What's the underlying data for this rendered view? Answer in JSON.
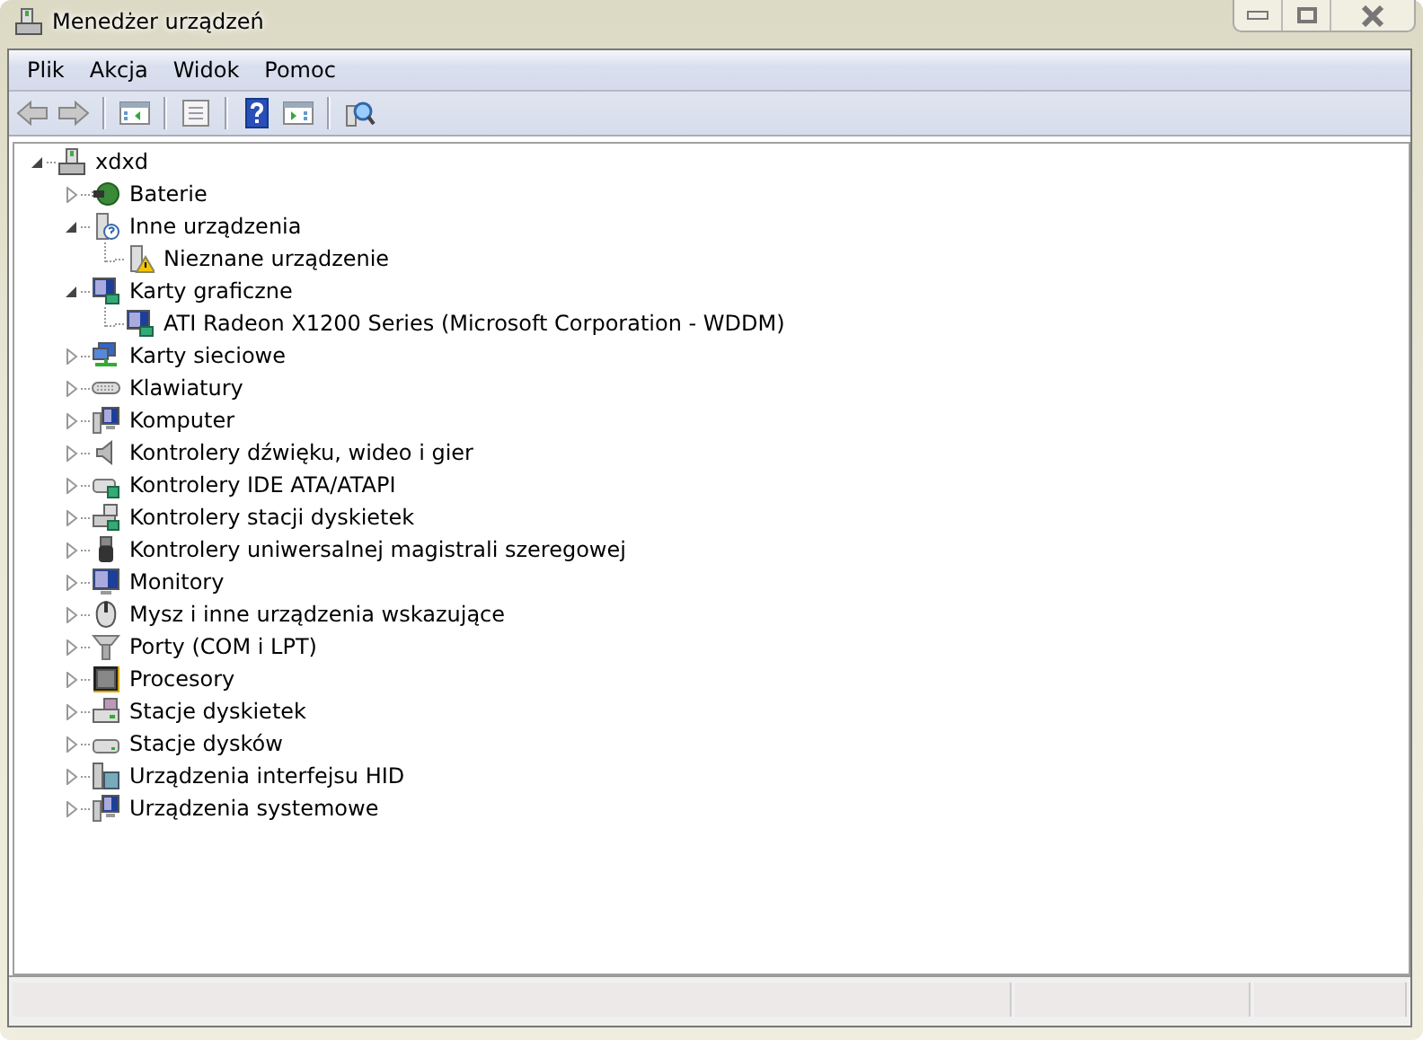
{
  "window": {
    "title": "Menedżer urządzeń"
  },
  "menu": [
    "Plik",
    "Akcja",
    "Widok",
    "Pomoc"
  ],
  "toolbar": [
    {
      "kind": "back"
    },
    {
      "kind": "forward"
    },
    {
      "kind": "separator"
    },
    {
      "kind": "tree-pane"
    },
    {
      "kind": "separator"
    },
    {
      "kind": "properties"
    },
    {
      "kind": "separator"
    },
    {
      "kind": "help"
    },
    {
      "kind": "action-pane"
    },
    {
      "kind": "separator"
    },
    {
      "kind": "scan"
    }
  ],
  "tree": {
    "label": "xdxd",
    "kind": "computer",
    "expanded": true,
    "children": [
      {
        "label": "Baterie",
        "kind": "battery",
        "expanded": false
      },
      {
        "label": "Inne urządzenia",
        "kind": "other",
        "expanded": true,
        "children": [
          {
            "label": "Nieznane urządzenie",
            "kind": "unknown"
          }
        ]
      },
      {
        "label": "Karty graficzne",
        "kind": "display",
        "expanded": true,
        "children": [
          {
            "label": "ATI Radeon X1200 Series (Microsoft Corporation - WDDM)",
            "kind": "display"
          }
        ]
      },
      {
        "label": "Karty sieciowe",
        "kind": "network",
        "expanded": false
      },
      {
        "label": "Klawiatury",
        "kind": "keyboard",
        "expanded": false
      },
      {
        "label": "Komputer",
        "kind": "pc",
        "expanded": false
      },
      {
        "label": "Kontrolery dźwięku, wideo i gier",
        "kind": "sound",
        "expanded": false
      },
      {
        "label": "Kontrolery IDE ATA/ATAPI",
        "kind": "controller",
        "expanded": false
      },
      {
        "label": "Kontrolery stacji dyskietek",
        "kind": "floppy-controller",
        "expanded": false
      },
      {
        "label": "Kontrolery uniwersalnej magistrali szeregowej",
        "kind": "usb",
        "expanded": false
      },
      {
        "label": "Monitory",
        "kind": "monitor",
        "expanded": false
      },
      {
        "label": "Mysz i inne urządzenia wskazujące",
        "kind": "mouse",
        "expanded": false
      },
      {
        "label": "Porty (COM i LPT)",
        "kind": "port",
        "expanded": false
      },
      {
        "label": "Procesory",
        "kind": "cpu",
        "expanded": false
      },
      {
        "label": "Stacje dyskietek",
        "kind": "floppy",
        "expanded": false
      },
      {
        "label": "Stacje dysków",
        "kind": "disk",
        "expanded": false
      },
      {
        "label": "Urządzenia interfejsu HID",
        "kind": "hid",
        "expanded": false
      },
      {
        "label": "Urządzenia systemowe",
        "kind": "pc",
        "expanded": false
      }
    ]
  }
}
